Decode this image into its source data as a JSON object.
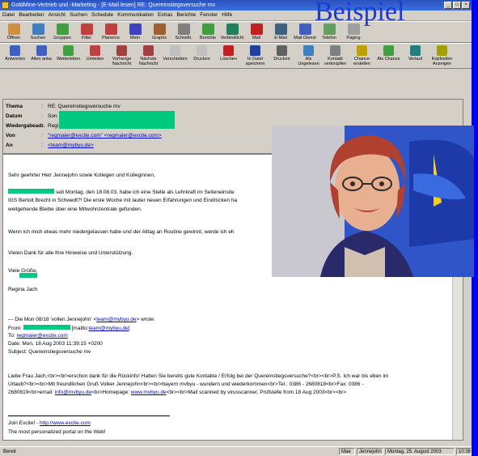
{
  "window": {
    "title": "GoldMine-Vertrieb und -Marketing - [E-Mail lesen] RE: Quereinstiegsversuche mv",
    "overlay_label": "Beispiel"
  },
  "menubar": [
    "Datei",
    "Bearbeiten",
    "Ansicht",
    "Suchen",
    "Schedule",
    "Kommunikation",
    "Extras",
    "Berichte",
    "Fenster",
    "Hilfe"
  ],
  "toolbar1": [
    {
      "label": "Öffnen",
      "icon": "open-icon",
      "color": "#d09040"
    },
    {
      "label": "Suchen",
      "icon": "find-icon",
      "color": "#4080c0"
    },
    {
      "label": "Gruppen",
      "icon": "groups-icon",
      "color": "#40a040"
    },
    {
      "label": "Filter",
      "icon": "filter-icon",
      "color": "#c04040"
    },
    {
      "label": "Planerns",
      "icon": "calendar-icon",
      "color": "#c04040"
    },
    {
      "label": "Mein",
      "icon": "user-icon",
      "color": "#4040c0"
    },
    {
      "label": "Graphs",
      "icon": "chart-icon",
      "color": "#a06030"
    },
    {
      "label": "Schnellr.",
      "icon": "quick-icon",
      "color": "#808080"
    },
    {
      "label": "Berichte",
      "icon": "report-icon",
      "color": "#40a040"
    },
    {
      "label": "Verbindlicht",
      "icon": "link-icon",
      "color": "#208060"
    },
    {
      "label": "Mail",
      "icon": "mail-icon",
      "color": "#c02020"
    },
    {
      "label": "E-Mail",
      "icon": "email-icon",
      "color": "#406080"
    },
    {
      "label": "Mail-Dienst",
      "icon": "mail-service-icon",
      "color": "#4060c0"
    },
    {
      "label": "Telefon",
      "icon": "phone-icon",
      "color": "#60a060"
    },
    {
      "label": "Paging",
      "icon": "pager-icon",
      "color": "#a0a0a0"
    }
  ],
  "toolbar2": [
    {
      "label": "Antworten",
      "icon": "reply-icon",
      "color": "#4060c0"
    },
    {
      "label": "Allen antw.",
      "icon": "reply-all-icon",
      "color": "#4060c0"
    },
    {
      "label": "Weiterleiten",
      "icon": "forward-icon",
      "color": "#40a040"
    },
    {
      "label": "Umleiten",
      "icon": "redirect-icon",
      "color": "#c04040"
    },
    {
      "label": "Vorherige Nachricht",
      "icon": "prev-icon",
      "color": "#a04040"
    },
    {
      "label": "Nächste Nachricht",
      "icon": "next-icon",
      "color": "#a04040"
    },
    {
      "label": "Verschieben",
      "icon": "move-icon",
      "color": "#c0c0c0"
    },
    {
      "label": "Drucken",
      "icon": "print-icon",
      "color": "#c0c0c0"
    },
    {
      "label": "Löschen",
      "icon": "delete-icon",
      "color": "#c02020"
    },
    {
      "label": "In Datei speichern",
      "icon": "save-icon",
      "color": "#2040a0"
    },
    {
      "label": "Drucken",
      "icon": "printer-icon",
      "color": "#606060"
    },
    {
      "label": "Als Ungelesen",
      "icon": "unread-icon",
      "color": "#4080c0"
    },
    {
      "label": "Kontakt verknüpfen",
      "icon": "contact-icon",
      "color": "#808080"
    },
    {
      "label": "Chance erstellen",
      "icon": "chance-icon",
      "color": "#c0a000"
    },
    {
      "label": "Als Chance",
      "icon": "tag-icon",
      "color": "#40a040"
    },
    {
      "label": "Verlauf",
      "icon": "history-icon",
      "color": "#208080"
    },
    {
      "label": "Kopfzeilen Anzeigen",
      "icon": "header-icon",
      "color": "#a0a000"
    }
  ],
  "headers": {
    "subject_label": "Thema",
    "subject": "RE: Quereinstiegsversuche mv",
    "date_label": "Datum",
    "date": "Son",
    "reply_label": "Wiedergabeadr.",
    "reply": "Regi",
    "from_label": "Von",
    "from": "\"regmaier@excite.com\" <regmaier@excite.com>",
    "to_label": "An",
    "to": "<team@mybyu.de>"
  },
  "body": {
    "greeting": "Sehr geehrter Herr Jennejohn sowie Kollegen und Kolleginnen,",
    "p1a": "seit Montag, den 18.08.03, habe ich eine Stelle als Lehrkraft im Seiteneinstie",
    "p1b": "IGS Bertolt Brecht in Schwedt?! Die erste Woche mit lauter neuen Erfahrungen und Eindrücken ha",
    "p1c": "weitgehende Bleibe über eine Mitwohnzentrale gefunden.",
    "p2": "Wenn ich mich etwas mehr niedergelassen habe und der Alltag an Routine gewinnt, werde ich eh",
    "p3": "Vielen Dank für alle Ihre Hinweise und Unterstützung.",
    "closing": "Viele Grüße,",
    "signature": "Regina Jach",
    "quote_intro_pre": "--- Die Mon 08/18 'vollen Jennejohn' <",
    "quote_intro_link": "team@mybyu.de",
    "quote_intro_post": "> wrote:",
    "from_line_pre": "From:",
    "from_line_mid": "[mailto:",
    "from_line_link": "team@mybyu.de",
    "from_line_post": "]",
    "to_line_pre": "To:",
    "to_line_link": "regmaier@excite.com",
    "date_line": "Date: Mon, 18 Aug 2003 11:39:15 +0200",
    "subject_line": "Subject: Quereinstiegsversuche mv",
    "html_line1": "Liebe Frau Jach,<br><br>erschon dank für die Rückinfo! Hatten Sie bereits gute Kontakte / Erfolg bei der Quereinstiegsversuche?<br><br>P.S. Ich war bis eben im",
    "html_line2": "Urlaub?<br><br>Mit freundlichen Gruß Volker Jennejohn<br><br>bayern mvbyu - wundern und wiederkommen<br>Tel.: 0386 - 2680818<br>Fax: 0386 -",
    "html_line3_pre": "2680819<br>email:",
    "html_line3_link1": "info@mvbyu.de",
    "html_line3_mid": "<br>Homepage:",
    "html_line3_link2": "www.mvbyu.de",
    "html_line3_post": "<br><br>Mail scanned by virusscanner, Prüfstelle from 18 Aug 2003<br><br>",
    "footer1_pre": "Join Excite! -",
    "footer1_link": "http://www.excite.com",
    "footer2": "The most personalized portal on the Web!"
  },
  "status": {
    "left": "Bereit",
    "user": "Mae",
    "name": "Jennejohn",
    "date": "Montag, 25. August 2003",
    "time": "10:38"
  },
  "colors": {
    "redaction": "#00c880",
    "title_gradient_start": "#2a52be",
    "desktop": "#0000ff",
    "overlay_text": "#1c3cd0"
  }
}
